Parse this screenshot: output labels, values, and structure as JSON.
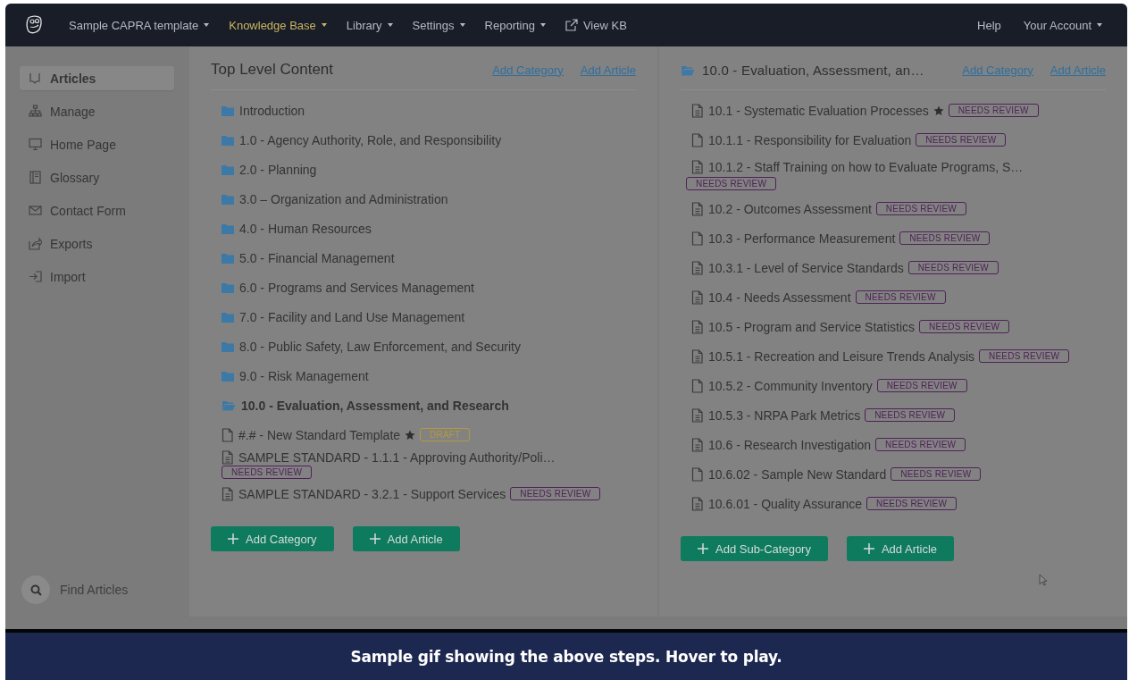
{
  "nav": {
    "items": [
      {
        "label": "Sample CAPRA template",
        "dropdown": true,
        "selected": false
      },
      {
        "label": "Knowledge Base",
        "dropdown": true,
        "selected": true
      },
      {
        "label": "Library",
        "dropdown": true,
        "selected": false
      },
      {
        "label": "Settings",
        "dropdown": true,
        "selected": false
      },
      {
        "label": "Reporting",
        "dropdown": true,
        "selected": false
      },
      {
        "label": "View KB",
        "dropdown": false,
        "selected": false,
        "kind": "external"
      }
    ],
    "right": [
      {
        "label": "Help",
        "dropdown": false
      },
      {
        "label": "Your Account",
        "dropdown": true
      }
    ]
  },
  "sidebar": {
    "items": [
      {
        "label": "Articles",
        "selected": true
      },
      {
        "label": "Manage",
        "selected": false
      },
      {
        "label": "Home Page",
        "selected": false
      },
      {
        "label": "Glossary",
        "selected": false
      },
      {
        "label": "Contact Form",
        "selected": false
      },
      {
        "label": "Exports",
        "selected": false
      },
      {
        "label": "Import",
        "selected": false
      }
    ],
    "search": {
      "placeholder": "Find Articles"
    }
  },
  "left": {
    "title": "Top Level Content",
    "links": [
      "Add Category",
      "Add Article"
    ],
    "items": [
      {
        "kind": "folder",
        "label": "Introduction",
        "selected": false
      },
      {
        "kind": "folder",
        "label": "1.0 - Agency Authority, Role, and Responsibility",
        "selected": false
      },
      {
        "kind": "folder",
        "label": "2.0 - Planning",
        "selected": false
      },
      {
        "kind": "folder",
        "label": "3.0 – Organization and Administration",
        "selected": false
      },
      {
        "kind": "folder",
        "label": "4.0 - Human Resources",
        "selected": false
      },
      {
        "kind": "folder",
        "label": "5.0 - Financial Management",
        "selected": false
      },
      {
        "kind": "folder",
        "label": "6.0 - Programs and Services Management",
        "selected": false
      },
      {
        "kind": "folder",
        "label": "7.0 - Facility and Land Use Management",
        "selected": false
      },
      {
        "kind": "folder",
        "label": "8.0 - Public Safety, Law Enforcement, and Security",
        "selected": false
      },
      {
        "kind": "folder",
        "label": "9.0 - Risk Management",
        "selected": false
      },
      {
        "kind": "folder-open",
        "label": "10.0 - Evaluation, Assessment, and Research",
        "selected": true
      },
      {
        "kind": "doc",
        "label": "#.# - New Standard Template",
        "selected": false,
        "starred": true,
        "badge": {
          "text": "DRAFT",
          "color": "#b49a3c"
        }
      },
      {
        "kind": "doc-lines",
        "label": "SAMPLE STANDARD - 1.1.1 - Approving Authority/Poli…",
        "selected": false,
        "badge": {
          "text": "NEEDS REVIEW",
          "color": "#4f2257"
        }
      },
      {
        "kind": "doc-lines",
        "label": "SAMPLE STANDARD - 3.2.1 - Support Services",
        "selected": false,
        "badge": {
          "text": "NEEDS REVIEW",
          "color": "#4f2257"
        }
      }
    ],
    "buttons": [
      "Add Category",
      "Add Article"
    ]
  },
  "right": {
    "title": "10.0 - Evaluation, Assessment, an…",
    "links": [
      "Add Category",
      "Add Article"
    ],
    "items": [
      {
        "kind": "doc-lines",
        "label": "10.1 - Systematic Evaluation Processes",
        "starred": true,
        "badge": {
          "text": "NEEDS REVIEW",
          "color": "#4f2257"
        }
      },
      {
        "kind": "doc",
        "label": "10.1.1 - Responsibility for Evaluation",
        "badge": {
          "text": "NEEDS REVIEW",
          "color": "#4f2257"
        }
      },
      {
        "kind": "doc-lines",
        "label": "10.1.2 - Staff Training on how to Evaluate Programs, S…",
        "badge": {
          "text": "NEEDS REVIEW",
          "color": "#4f2257"
        }
      },
      {
        "kind": "doc-lines",
        "label": "10.2 - Outcomes Assessment",
        "badge": {
          "text": "NEEDS REVIEW",
          "color": "#4f2257"
        }
      },
      {
        "kind": "doc",
        "label": "10.3 - Performance Measurement",
        "badge": {
          "text": "NEEDS REVIEW",
          "color": "#4f2257"
        }
      },
      {
        "kind": "doc-lines",
        "label": "10.3.1 - Level of Service Standards",
        "badge": {
          "text": "NEEDS REVIEW",
          "color": "#4f2257"
        }
      },
      {
        "kind": "doc-lines",
        "label": "10.4 - Needs Assessment",
        "badge": {
          "text": "NEEDS REVIEW",
          "color": "#4f2257"
        }
      },
      {
        "kind": "doc-lines",
        "label": "10.5 - Program and Service Statistics",
        "badge": {
          "text": "NEEDS REVIEW",
          "color": "#4f2257"
        }
      },
      {
        "kind": "doc-lines",
        "label": "10.5.1 - Recreation and Leisure Trends Analysis",
        "badge": {
          "text": "NEEDS REVIEW",
          "color": "#4f2257"
        }
      },
      {
        "kind": "doc",
        "label": "10.5.2 - Community Inventory",
        "badge": {
          "text": "NEEDS REVIEW",
          "color": "#4f2257"
        }
      },
      {
        "kind": "doc-lines",
        "label": "10.5.3 - NRPA Park Metrics",
        "badge": {
          "text": "NEEDS REVIEW",
          "color": "#4f2257"
        }
      },
      {
        "kind": "doc-lines",
        "label": "10.6 - Research Investigation",
        "badge": {
          "text": "NEEDS REVIEW",
          "color": "#4f2257"
        }
      },
      {
        "kind": "doc",
        "label": "10.6.02 - Sample New Standard",
        "badge": {
          "text": "NEEDS REVIEW",
          "color": "#4f2257"
        }
      },
      {
        "kind": "doc-lines",
        "label": "10.6.01 - Quality Assurance",
        "badge": {
          "text": "NEEDS REVIEW",
          "color": "#4f2257"
        }
      }
    ],
    "buttons": [
      "Add Sub-Category",
      "Add Article"
    ]
  },
  "caption": "Sample gif showing the above steps. Hover to play."
}
